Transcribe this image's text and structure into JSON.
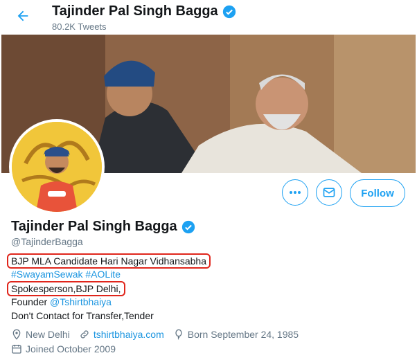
{
  "header": {
    "back_icon": "arrow-left-icon",
    "name": "Tajinder Pal Singh Bagga",
    "verified_icon": "verified-badge-icon",
    "tweet_count": "80.2K Tweets"
  },
  "profile": {
    "name": "Tajinder Pal Singh Bagga",
    "handle": "@TajinderBagga",
    "bio": {
      "line1": "BJP MLA Candidate Hari Nagar Vidhansabha",
      "line2_tag1": "#SwayamSewak",
      "line2_tag2": "#AOLite",
      "line3": "Spokesperson,BJP Delhi,",
      "line4_prefix": "Founder",
      "line4_mention": "@Tshirtbhaiya",
      "line5": "Don't Contact for Transfer,Tender"
    },
    "location": "New Delhi",
    "website": "tshirtbhaiya.com",
    "birthday": "Born September 24, 1985",
    "joined": "Joined October 2009"
  },
  "actions": {
    "more_icon": "more-dots-icon",
    "message_icon": "mail-icon",
    "follow_label": "Follow"
  },
  "colors": {
    "accent": "#1da1f2",
    "highlight_box": "#e0251b",
    "secondary_text": "#657786"
  }
}
